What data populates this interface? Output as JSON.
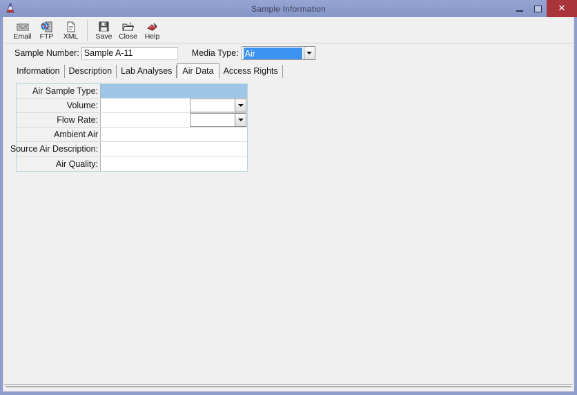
{
  "window": {
    "title": "Sample Information",
    "app_icon": "flask-icon",
    "controls": {
      "minimize": "minimize-icon",
      "maximize": "maximize-icon",
      "close": "✕"
    },
    "colors": {
      "titlebar": "#8d9ccc",
      "close_button": "#a93439",
      "client_background": "#f0f0f0",
      "row_highlight": "#9fc6e4",
      "selection_blue": "#3d94f0",
      "grid_border": "#b9d3dc"
    }
  },
  "toolbar": {
    "groups": [
      {
        "buttons": [
          {
            "label": "Email",
            "icon": "envelope-icon"
          },
          {
            "label": "FTP",
            "icon": "ftp-server-icon"
          },
          {
            "label": "XML",
            "icon": "xml-document-icon"
          }
        ]
      },
      {
        "buttons": [
          {
            "label": "Save",
            "icon": "floppy-disk-icon"
          },
          {
            "label": "Close",
            "icon": "open-folder-icon"
          },
          {
            "label": "Help",
            "icon": "help-book-icon"
          }
        ]
      }
    ]
  },
  "header_fields": {
    "sample_number": {
      "label": "Sample Number:",
      "value": "Sample A-11"
    },
    "media_type": {
      "label": "Media Type:",
      "value": "Air",
      "selected": true
    }
  },
  "tabs": {
    "active_index": 3,
    "items": [
      {
        "label": "Information"
      },
      {
        "label": "Description"
      },
      {
        "label": "Lab Analyses"
      },
      {
        "label": "Air Data"
      },
      {
        "label": "Access Rights"
      }
    ]
  },
  "air_data_grid": {
    "rows": [
      {
        "label": "Air Sample Type:",
        "value": "",
        "highlighted": true,
        "combo": false
      },
      {
        "label": "Volume:",
        "value": "",
        "highlighted": false,
        "combo": true
      },
      {
        "label": "Flow Rate:",
        "value": "",
        "highlighted": false,
        "combo": true
      },
      {
        "label": "Ambient Air",
        "value": "",
        "highlighted": false,
        "combo": false
      },
      {
        "label": "Source Air Description:",
        "value": "",
        "highlighted": false,
        "combo": false
      },
      {
        "label": "Air Quality:",
        "value": "",
        "highlighted": false,
        "combo": false
      }
    ]
  }
}
